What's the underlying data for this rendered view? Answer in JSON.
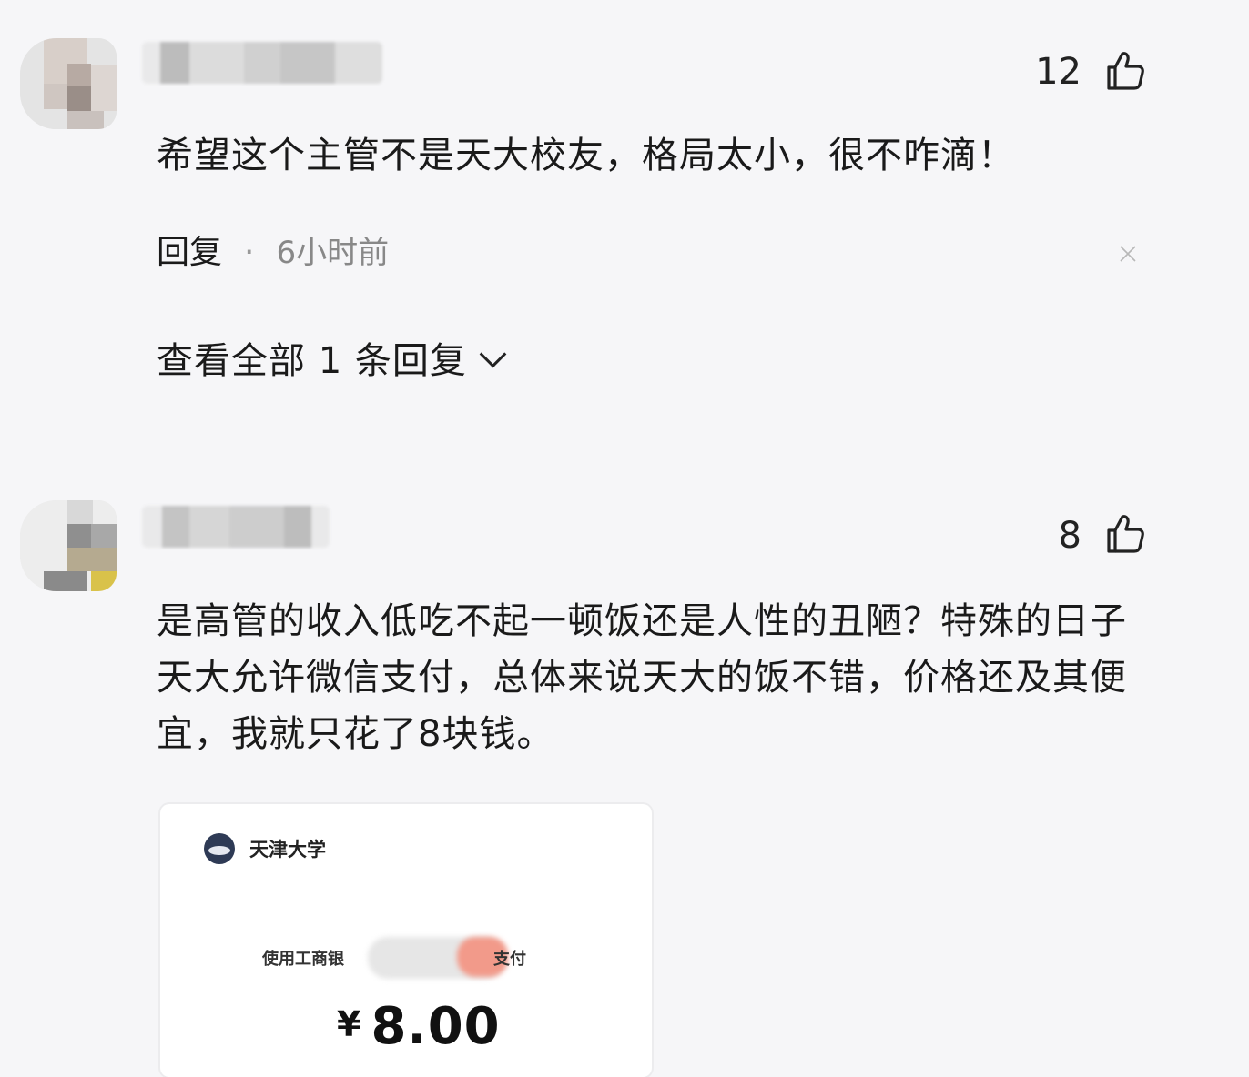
{
  "comments": [
    {
      "likes": "12",
      "text": "希望这个主管不是天大校友，格局太小，很不咋滴！",
      "reply_label": "回复",
      "dot": "·",
      "time": "6小时前",
      "view_all_replies": "查看全部 1 条回复"
    },
    {
      "likes": "8",
      "text": "是高管的收入低吃不起一顿饭还是人性的丑陋？特殊的日子天大允许微信支付，总体来说天大的饭不错，价格还及其便宜，我就只花了8块钱。",
      "receipt": {
        "school": "天津大学",
        "pay_prefix": "使用工商银",
        "pay_suffix": "支付",
        "currency": "¥",
        "amount": "8.00"
      }
    }
  ],
  "icons": {
    "like": "thumbs-up-icon",
    "close": "close-icon",
    "expand": "chevron-down-icon"
  },
  "colors": {
    "background": "#f6f6f8",
    "text": "#1a1a1a",
    "muted": "#888888"
  }
}
